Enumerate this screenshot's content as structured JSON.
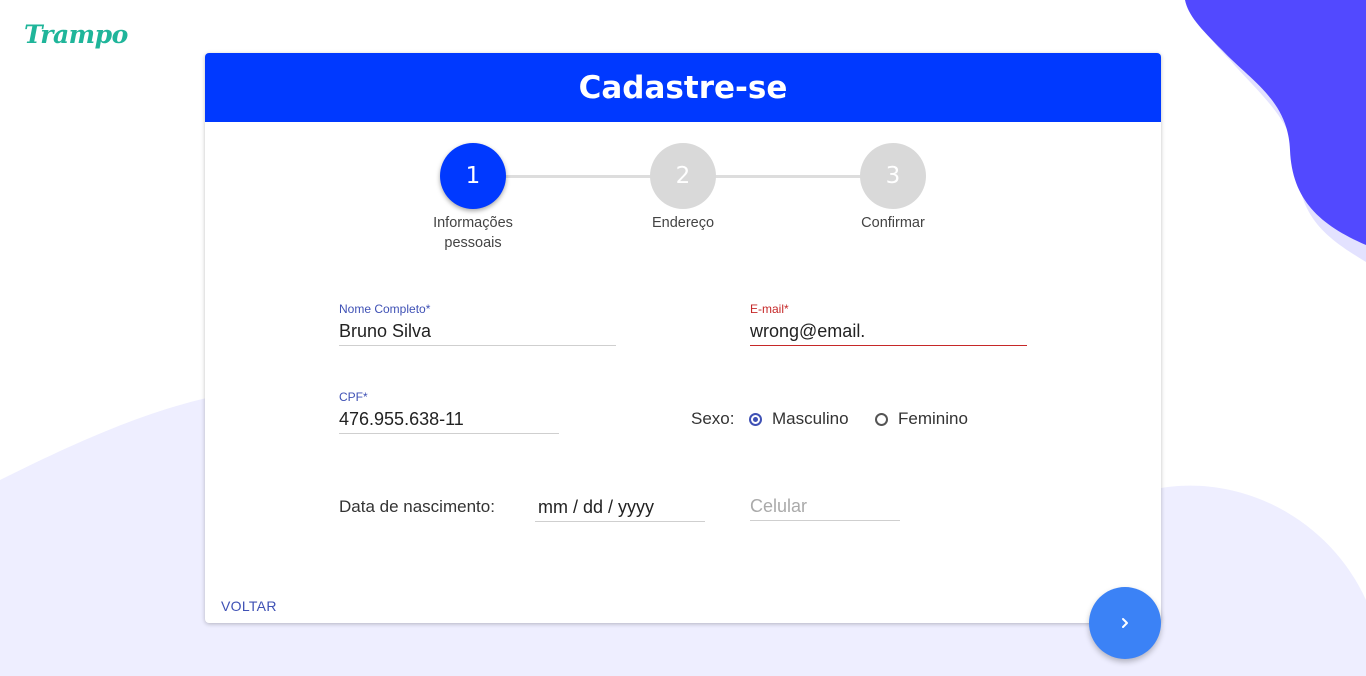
{
  "brand": {
    "logo_text": "Trampo"
  },
  "form": {
    "title": "Cadastre-se",
    "steps": [
      {
        "number": "1",
        "label": "Informações pessoais",
        "active": true
      },
      {
        "number": "2",
        "label": "Endereço",
        "active": false
      },
      {
        "number": "3",
        "label": "Confirmar",
        "active": false
      }
    ],
    "fields": {
      "name": {
        "label": "Nome Completo*",
        "value": "Bruno Silva"
      },
      "email": {
        "label": "E-mail*",
        "value": "wrong@email.",
        "state": "error"
      },
      "cpf": {
        "label": "CPF*",
        "value": "476.955.638-11"
      },
      "gender": {
        "label": "Sexo:",
        "options": [
          "Masculino",
          "Feminino"
        ],
        "selected": "Masculino"
      },
      "birthdate": {
        "label": "Data de nascimento:",
        "value": "mm / dd / yyyy"
      },
      "phone": {
        "placeholder": "Celular",
        "value": ""
      }
    },
    "back_label": "VOLTAR",
    "next_icon": "chevron-right-icon"
  },
  "colors": {
    "primary": "#0039ff",
    "accent": "#3f51b5",
    "error": "#c62828",
    "fab": "#3b82f6",
    "blob": "#5249ff",
    "background_wave": "#eeeeff",
    "logo": "#1fb59a"
  }
}
